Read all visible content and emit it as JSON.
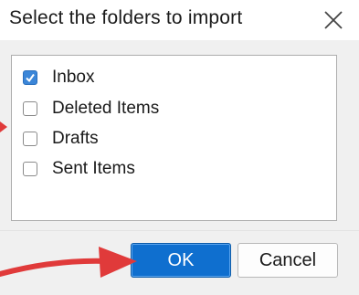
{
  "dialog": {
    "title": "Select the folders to import",
    "close_icon": "close-x-icon"
  },
  "folders": [
    {
      "label": "Inbox",
      "checked": true
    },
    {
      "label": "Deleted Items",
      "checked": false
    },
    {
      "label": "Drafts",
      "checked": false
    },
    {
      "label": "Sent Items",
      "checked": false
    }
  ],
  "buttons": {
    "ok_label": "OK",
    "cancel_label": "Cancel"
  },
  "colors": {
    "accent": "#0f6fcf",
    "checkbox_checked": "#3b86d8",
    "annotation_arrow": "#e03a3a"
  }
}
